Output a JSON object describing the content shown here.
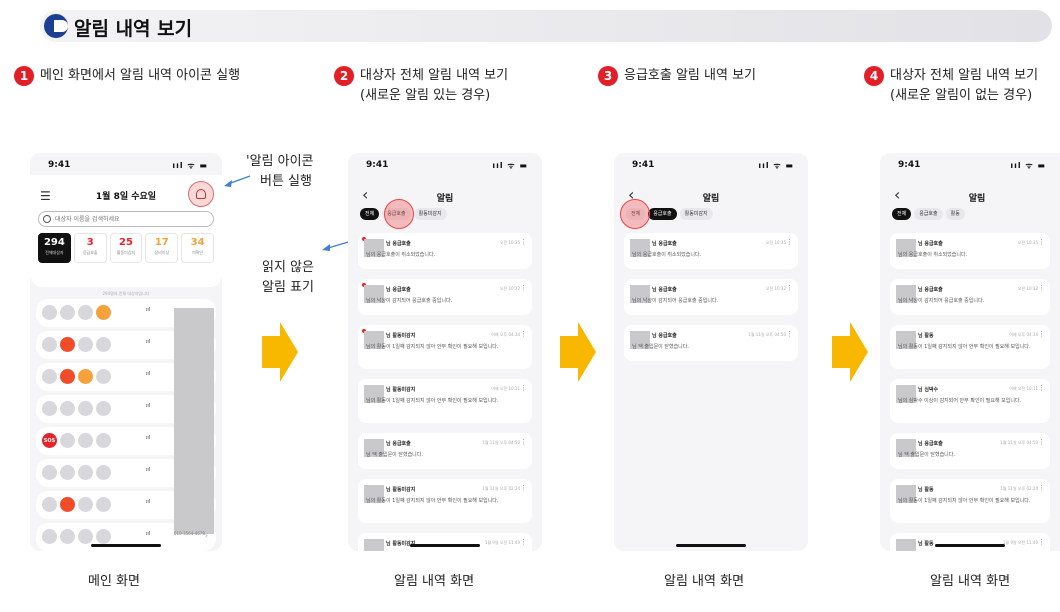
{
  "header": {
    "title": "알림 내역 보기"
  },
  "steps": [
    {
      "num": "1",
      "line1": "메인 화면에서 알림 내역 아이콘 실행",
      "line2": ""
    },
    {
      "num": "2",
      "line1": "대상자 전체 알림 내역 보기",
      "line2": "(새로운 알림 있는 경우)"
    },
    {
      "num": "3",
      "line1": "응급호출 알림 내역 보기",
      "line2": ""
    },
    {
      "num": "4",
      "line1": "대상자 전체 알림 내역 보기",
      "line2": "(새로운 알림이 없는 경우)"
    }
  ],
  "annotations": {
    "bell": {
      "line1": "'알림 아이콘",
      "line2": "버튼 실행"
    },
    "unread": {
      "line1": "읽지 않은",
      "line2": "알림 표기"
    }
  },
  "status": {
    "time": "9:41",
    "icons": "ııl ᯤ ▬"
  },
  "main_screen": {
    "date": "1월 8일 수요일",
    "search_placeholder": "대상자 이름을 검색하세요",
    "stats": [
      {
        "value": "294",
        "label": "전체대상자",
        "color": "#ffffff"
      },
      {
        "value": "3",
        "label": "응급호출",
        "color": "#e5242b"
      },
      {
        "value": "25",
        "label": "활동미감지",
        "color": "#e5242b"
      },
      {
        "value": "17",
        "label": "장비이상",
        "color": "#f5a13c"
      },
      {
        "value": "34",
        "label": "미확인",
        "color": "#f5a13c"
      }
    ],
    "list_caption": "294명의 전체 대상자입니다",
    "row_signal": "ııl",
    "row_chevron": "›",
    "phone_partial": "010-3564-4678",
    "sos": "SOS"
  },
  "notif_screen": {
    "title": "알림",
    "back": "‹",
    "more": "⋮"
  },
  "screens": {
    "s2": {
      "tabs": [
        "전체",
        "응급호출",
        "활동미감지"
      ],
      "cards": [
        {
          "title": "님 응급호출",
          "time": "오전 10:35",
          "body": "님의 응급호출이 취소되었습니다.",
          "unread": true
        },
        {
          "title": "님 응급호출",
          "time": "오전 10:32",
          "body": "님의 낙상이 감지되어 응급호출 중입니다.",
          "unread": true
        },
        {
          "title": "님 활동미감지",
          "time": "어제 오후 04:34",
          "body": "님의 활동이 1일째 감지되지 않아 안부 확인이 필요해 보입니다.",
          "unread": true
        },
        {
          "title": "님 활동미감지",
          "time": "어제 오전 10:11",
          "body": "님의 활동이 1일째 감지되지 않아 안부 확인이 필요해 보입니다.",
          "unread": false
        },
        {
          "title": "님 응급호출",
          "time": "1월 11일 오후 04:50",
          "body": "님 댁 출입문이 닫혔습니다.",
          "unread": false
        },
        {
          "title": "님 활동미감지",
          "time": "1월 11일 오후 02:24",
          "body": "님의 활동이 1일째 감지되지 않아 안부 확인이 필요해 보입니다.",
          "unread": false
        },
        {
          "title": "님 활동미감지",
          "time": "1월 9일 오전 11:49",
          "body": "",
          "unread": false
        }
      ]
    },
    "s3": {
      "tabs": [
        "전체",
        "응급호출",
        "활동미감지"
      ],
      "cards": [
        {
          "title": "님 응급호출",
          "time": "오전 10:35",
          "body": "님의 응급호출이 취소되었습니다."
        },
        {
          "title": "님 응급호출",
          "time": "오전 10:32",
          "body": "님의 낙상이 감지되어 응급호출 중입니다."
        },
        {
          "title": "님 응급호출",
          "time": "1월 11일 오후 04:50",
          "body": "님 댁 출입문이 닫혔습니다."
        }
      ]
    },
    "s4": {
      "tabs": [
        "전체",
        "응급호출",
        "활동"
      ],
      "cards": [
        {
          "title": "님 응급호출",
          "time": "오전 10:35",
          "body": "님의 응급호출이 취소되었습니다."
        },
        {
          "title": "님 응급호출",
          "time": "오전 10:32",
          "body": "님의 낙상이 감지되어 응급호출 중입니다."
        },
        {
          "title": "님 활동",
          "time": "어제 오후 04:34",
          "body": "님의 활동이 1일째 감지되지 않아 안부 확인이 필요해 보입니다."
        },
        {
          "title": "님 심박수",
          "time": "어제 오전 10:11",
          "body": "님의 심박수 이상이 감지되어 안부 확인이 필요해 보입니다."
        },
        {
          "title": "님 응급호출",
          "time": "1월 11일 오후 04:50",
          "body": "님 댁 출입문이 닫혔습니다."
        },
        {
          "title": "님 활동",
          "time": "1월 11일 오후 02:24",
          "body": "님의 활동이 1일째 감지되지 않아 안부 확인이 필요해 보입니다."
        },
        {
          "title": "님 활동",
          "time": "1월 9일 오전 11:49",
          "body": ""
        }
      ]
    }
  },
  "captions": [
    "메인 화면",
    "알림 내역 화면",
    "알림 내역 화면",
    "알림 내역 화면"
  ],
  "colors": {
    "accent_red": "#e21f26",
    "arrow": "#f9b800",
    "logo": "#1c3f94"
  }
}
